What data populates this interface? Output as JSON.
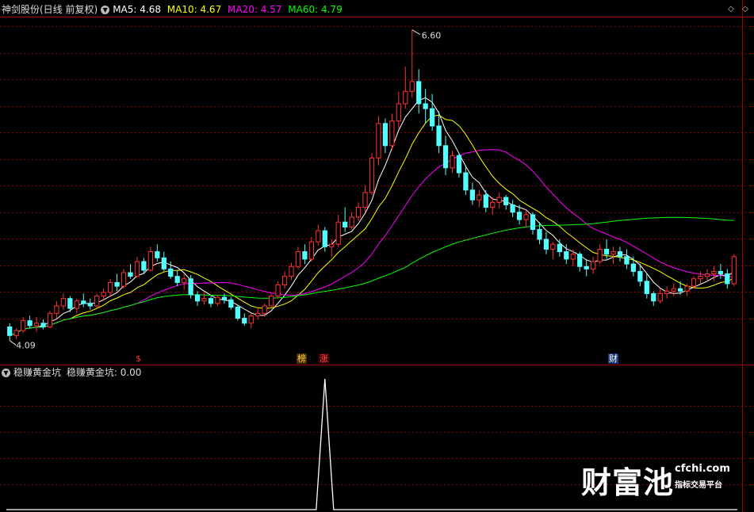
{
  "header": {
    "stock_title": "神剑股份(日线 前复权)",
    "ma5_label": "MA5: 4.68",
    "ma10_label": "MA10: 4.67",
    "ma20_label": "MA20: 4.57",
    "ma60_label": "MA60: 4.79",
    "dropdown_icon": "chevron-down-icon",
    "corner_icons": [
      "diamond-icon",
      "diamond-icon"
    ]
  },
  "main_chart": {
    "max_label": "6.60",
    "min_label": "4.09"
  },
  "markers": {
    "dollar": "$",
    "bang": "榜",
    "zhang": "涨",
    "cai": "财"
  },
  "indicator": {
    "title": "稳赚黄金坑",
    "value_label": "稳赚黄金坑: 0.00"
  },
  "watermark": {
    "brand": "财富池",
    "site": "cfchi.com",
    "tagline": "指标交易平台"
  },
  "colors": {
    "background": "#000000",
    "up": "#ff3232",
    "down": "#54ffff",
    "ma5": "#ffffff",
    "ma10": "#ffff00",
    "ma20": "#ff00ff",
    "ma60": "#00ff00",
    "grid": "#8b0000"
  },
  "chart_data": {
    "type": "candlestick",
    "price_range": [
      4.0,
      6.7
    ],
    "ohlc": [
      [
        4.19,
        4.22,
        4.08,
        4.12
      ],
      [
        4.12,
        4.18,
        4.09,
        4.16
      ],
      [
        4.16,
        4.27,
        4.14,
        4.24
      ],
      [
        4.24,
        4.28,
        4.18,
        4.2
      ],
      [
        4.2,
        4.27,
        4.15,
        4.22
      ],
      [
        4.22,
        4.25,
        4.17,
        4.19
      ],
      [
        4.19,
        4.32,
        4.18,
        4.3
      ],
      [
        4.3,
        4.4,
        4.26,
        4.36
      ],
      [
        4.36,
        4.46,
        4.33,
        4.42
      ],
      [
        4.42,
        4.44,
        4.31,
        4.34
      ],
      [
        4.34,
        4.42,
        4.3,
        4.4
      ],
      [
        4.4,
        4.46,
        4.35,
        4.38
      ],
      [
        4.38,
        4.42,
        4.33,
        4.36
      ],
      [
        4.36,
        4.46,
        4.34,
        4.44
      ],
      [
        4.44,
        4.5,
        4.4,
        4.47
      ],
      [
        4.47,
        4.58,
        4.44,
        4.55
      ],
      [
        4.55,
        4.62,
        4.48,
        4.52
      ],
      [
        4.52,
        4.66,
        4.5,
        4.63
      ],
      [
        4.63,
        4.7,
        4.58,
        4.6
      ],
      [
        4.6,
        4.76,
        4.59,
        4.72
      ],
      [
        4.72,
        4.75,
        4.62,
        4.65
      ],
      [
        4.65,
        4.84,
        4.64,
        4.8
      ],
      [
        4.8,
        4.86,
        4.72,
        4.75
      ],
      [
        4.75,
        4.8,
        4.64,
        4.66
      ],
      [
        4.66,
        4.72,
        4.58,
        4.6
      ],
      [
        4.6,
        4.65,
        4.52,
        4.55
      ],
      [
        4.55,
        4.62,
        4.49,
        4.58
      ],
      [
        4.58,
        4.61,
        4.42,
        4.45
      ],
      [
        4.45,
        4.48,
        4.36,
        4.4
      ],
      [
        4.4,
        4.47,
        4.37,
        4.42
      ],
      [
        4.42,
        4.44,
        4.35,
        4.38
      ],
      [
        4.38,
        4.45,
        4.36,
        4.43
      ],
      [
        4.43,
        4.46,
        4.38,
        4.41
      ],
      [
        4.41,
        4.43,
        4.33,
        4.35
      ],
      [
        4.35,
        4.37,
        4.24,
        4.26
      ],
      [
        4.26,
        4.3,
        4.2,
        4.22
      ],
      [
        4.22,
        4.3,
        4.18,
        4.28
      ],
      [
        4.28,
        4.34,
        4.25,
        4.3
      ],
      [
        4.3,
        4.38,
        4.27,
        4.36
      ],
      [
        4.36,
        4.46,
        4.35,
        4.44
      ],
      [
        4.44,
        4.56,
        4.42,
        4.53
      ],
      [
        4.53,
        4.64,
        4.5,
        4.6
      ],
      [
        4.6,
        4.71,
        4.57,
        4.68
      ],
      [
        4.68,
        4.84,
        4.66,
        4.8
      ],
      [
        4.8,
        4.86,
        4.7,
        4.74
      ],
      [
        4.74,
        4.92,
        4.72,
        4.88
      ],
      [
        4.88,
        5.02,
        4.85,
        4.97
      ],
      [
        4.97,
        5.0,
        4.8,
        4.84
      ],
      [
        4.84,
        4.9,
        4.76,
        4.86
      ],
      [
        4.86,
        5.1,
        4.84,
        5.04
      ],
      [
        5.04,
        5.16,
        4.96,
        5.0
      ],
      [
        5.0,
        5.12,
        4.98,
        5.08
      ],
      [
        5.08,
        5.2,
        5.05,
        5.16
      ],
      [
        5.16,
        5.34,
        5.12,
        5.28
      ],
      [
        5.28,
        5.6,
        5.26,
        5.56
      ],
      [
        5.56,
        5.9,
        5.5,
        5.84
      ],
      [
        5.84,
        5.88,
        5.6,
        5.66
      ],
      [
        5.66,
        5.92,
        5.62,
        5.86
      ],
      [
        5.86,
        6.1,
        5.8,
        6.0
      ],
      [
        6.0,
        6.3,
        5.96,
        6.1
      ],
      [
        6.1,
        6.6,
        6.05,
        6.18
      ],
      [
        6.18,
        6.28,
        5.92,
        6.0
      ],
      [
        6.0,
        6.12,
        5.84,
        5.96
      ],
      [
        5.96,
        6.08,
        5.78,
        5.82
      ],
      [
        5.82,
        5.94,
        5.6,
        5.66
      ],
      [
        5.66,
        5.74,
        5.42,
        5.48
      ],
      [
        5.48,
        5.62,
        5.44,
        5.58
      ],
      [
        5.58,
        5.6,
        5.4,
        5.44
      ],
      [
        5.44,
        5.5,
        5.26,
        5.3
      ],
      [
        5.3,
        5.36,
        5.18,
        5.22
      ],
      [
        5.22,
        5.3,
        5.16,
        5.26
      ],
      [
        5.26,
        5.3,
        5.12,
        5.16
      ],
      [
        5.16,
        5.24,
        5.1,
        5.2
      ],
      [
        5.2,
        5.28,
        5.15,
        5.24
      ],
      [
        5.24,
        5.26,
        5.14,
        5.18
      ],
      [
        5.18,
        5.22,
        5.08,
        5.12
      ],
      [
        5.12,
        5.18,
        5.02,
        5.06
      ],
      [
        5.06,
        5.14,
        5.0,
        5.1
      ],
      [
        5.1,
        5.12,
        4.94,
        4.98
      ],
      [
        4.98,
        5.04,
        4.86,
        4.9
      ],
      [
        4.9,
        4.96,
        4.78,
        4.82
      ],
      [
        4.82,
        4.88,
        4.74,
        4.86
      ],
      [
        4.86,
        4.9,
        4.76,
        4.8
      ],
      [
        4.8,
        4.86,
        4.7,
        4.74
      ],
      [
        4.74,
        4.82,
        4.68,
        4.78
      ],
      [
        4.78,
        4.8,
        4.64,
        4.68
      ],
      [
        4.68,
        4.74,
        4.6,
        4.66
      ],
      [
        4.66,
        4.76,
        4.62,
        4.72
      ],
      [
        4.72,
        4.86,
        4.7,
        4.82
      ],
      [
        4.82,
        4.9,
        4.74,
        4.78
      ],
      [
        4.78,
        4.84,
        4.7,
        4.8
      ],
      [
        4.8,
        4.84,
        4.72,
        4.76
      ],
      [
        4.76,
        4.82,
        4.66,
        4.7
      ],
      [
        4.7,
        4.76,
        4.6,
        4.64
      ],
      [
        4.64,
        4.7,
        4.52,
        4.56
      ],
      [
        4.56,
        4.62,
        4.42,
        4.46
      ],
      [
        4.46,
        4.48,
        4.36,
        4.4
      ],
      [
        4.4,
        4.5,
        4.38,
        4.46
      ],
      [
        4.46,
        4.52,
        4.42,
        4.48
      ],
      [
        4.48,
        4.54,
        4.44,
        4.5
      ],
      [
        4.5,
        4.56,
        4.45,
        4.48
      ],
      [
        4.48,
        4.54,
        4.44,
        4.52
      ],
      [
        4.52,
        4.6,
        4.5,
        4.58
      ],
      [
        4.58,
        4.64,
        4.54,
        4.6
      ],
      [
        4.6,
        4.66,
        4.56,
        4.62
      ],
      [
        4.62,
        4.68,
        4.56,
        4.64
      ],
      [
        4.64,
        4.7,
        4.58,
        4.62
      ],
      [
        4.62,
        4.66,
        4.5,
        4.54
      ],
      [
        4.54,
        4.78,
        4.52,
        4.76
      ]
    ],
    "ma_lengths": {
      "MA5": 5,
      "MA10": 10,
      "MA20": 20,
      "MA60": 60
    },
    "extremes": {
      "high": 6.6,
      "low": 4.09
    },
    "indicator_series": {
      "name": "稳赚黄金坑",
      "range": [
        0,
        1
      ],
      "spike_index": 47,
      "current": 0.0
    }
  }
}
